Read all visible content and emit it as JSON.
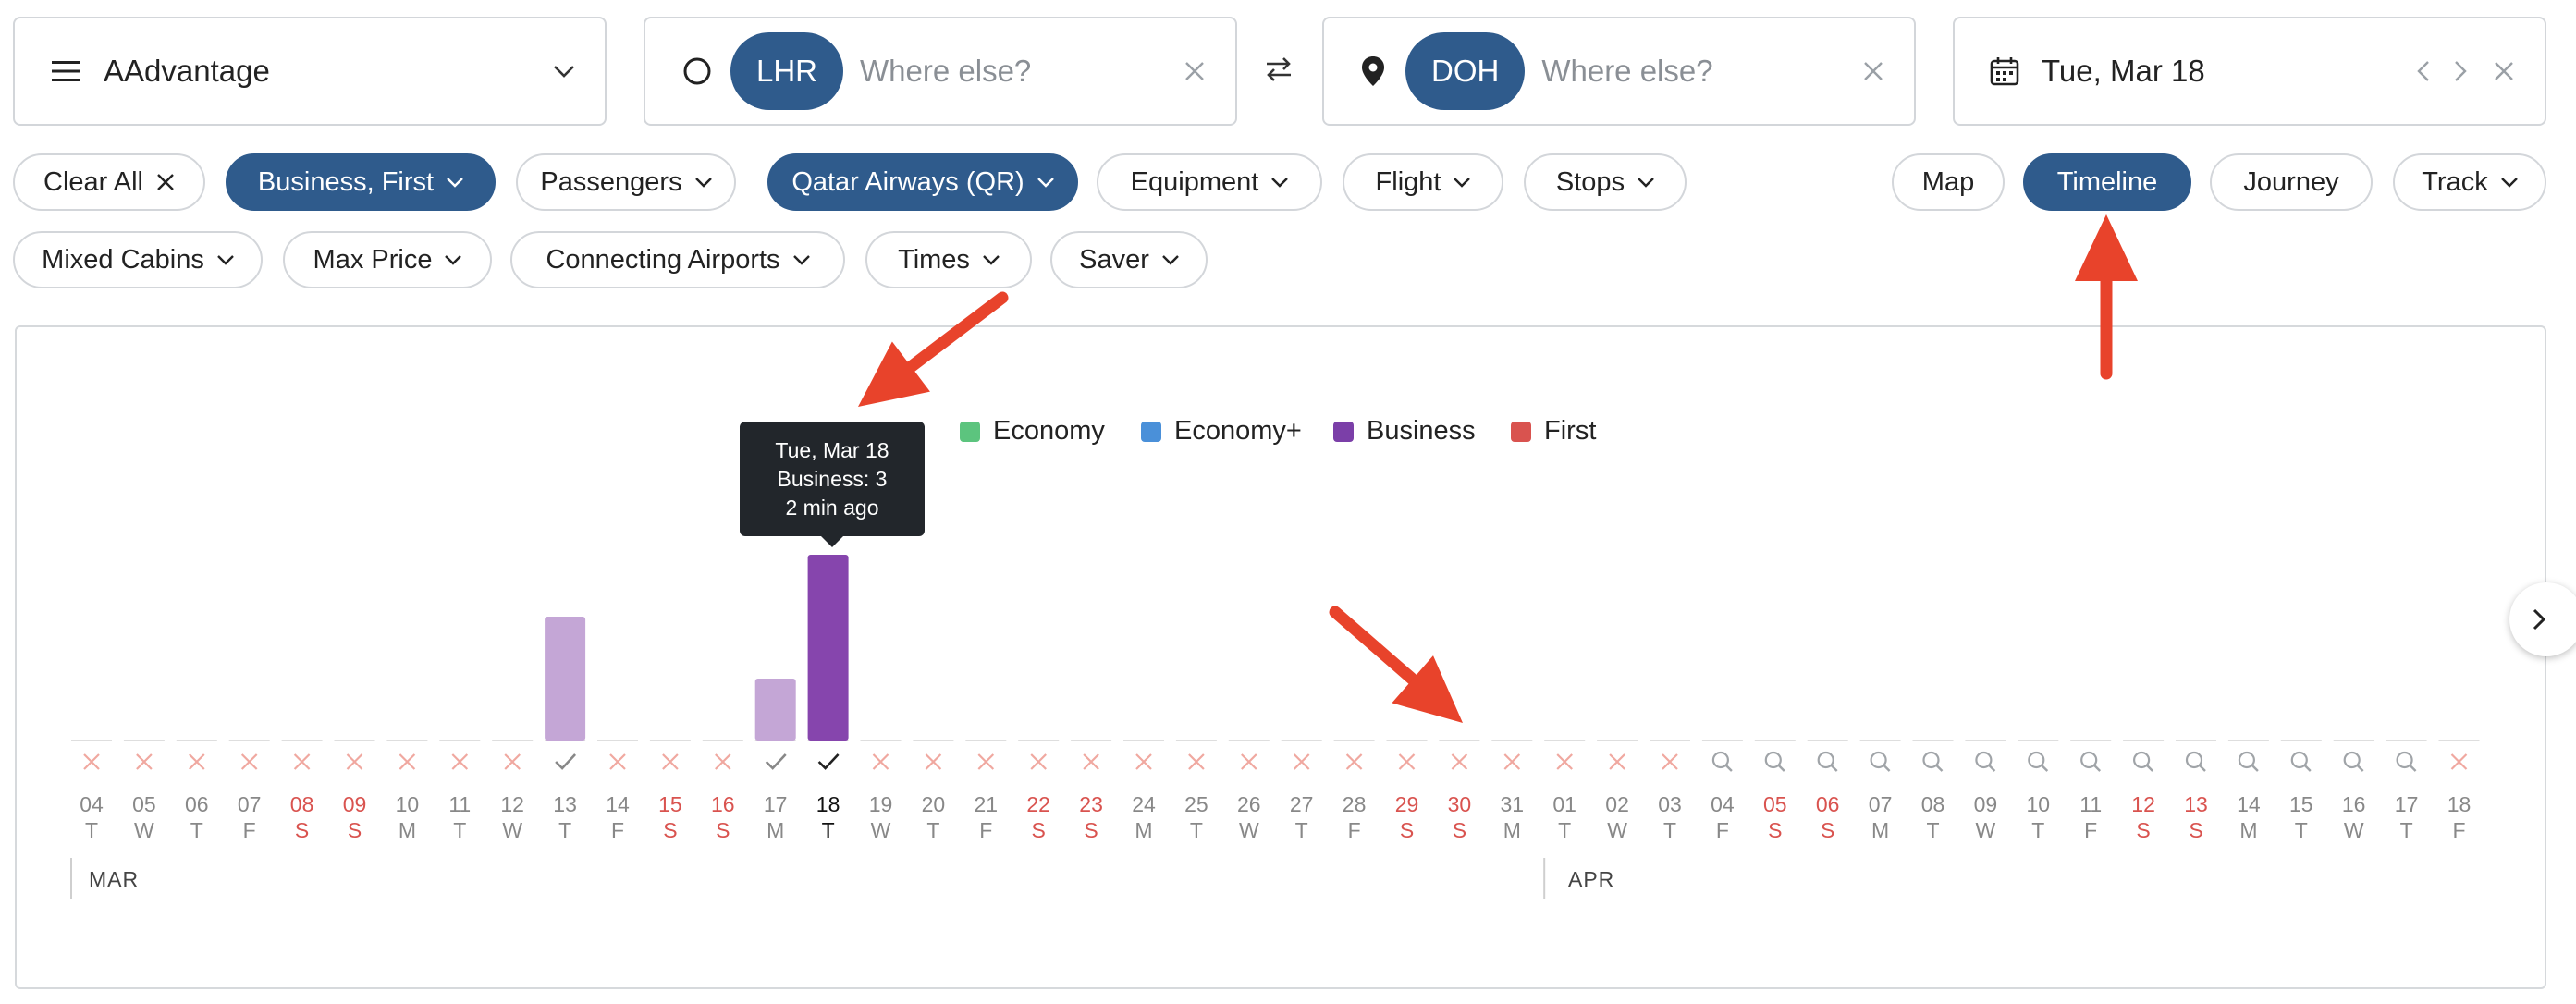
{
  "program": {
    "label": "AAdvantage"
  },
  "origin": {
    "code": "LHR",
    "placeholder": "Where else?"
  },
  "destination": {
    "code": "DOH",
    "placeholder": "Where else?"
  },
  "date": {
    "label": "Tue, Mar 18"
  },
  "filters_row1": [
    {
      "label": "Clear All",
      "active": false,
      "icon": "close-icon"
    },
    {
      "label": "Business, First",
      "active": true,
      "icon": "chevron-down-icon"
    },
    {
      "label": "Passengers",
      "active": false,
      "icon": "chevron-down-icon"
    },
    {
      "label": "Qatar Airways (QR)",
      "active": true,
      "icon": "chevron-down-icon"
    },
    {
      "label": "Equipment",
      "active": false,
      "icon": "chevron-down-icon"
    },
    {
      "label": "Flight",
      "active": false,
      "icon": "chevron-down-icon"
    },
    {
      "label": "Stops",
      "active": false,
      "icon": "chevron-down-icon"
    }
  ],
  "views": [
    {
      "label": "Map",
      "active": false
    },
    {
      "label": "Timeline",
      "active": true
    },
    {
      "label": "Journey",
      "active": false
    },
    {
      "label": "Track",
      "active": false,
      "icon": "chevron-down-icon"
    }
  ],
  "filters_row2": [
    {
      "label": "Mixed Cabins"
    },
    {
      "label": "Max Price"
    },
    {
      "label": "Connecting Airports"
    },
    {
      "label": "Times"
    },
    {
      "label": "Saver"
    }
  ],
  "legend": [
    {
      "label": "Economy",
      "color": "#5cc47e"
    },
    {
      "label": "Economy+",
      "color": "#4a90d9"
    },
    {
      "label": "Business",
      "color": "#7b3fa8"
    },
    {
      "label": "First",
      "color": "#d9534f"
    }
  ],
  "tooltip": {
    "date": "Tue, Mar 18",
    "detail": "Business: 3",
    "age": "2 min ago"
  },
  "colors": {
    "accent": "#2f5b8c",
    "business": "#8645ad",
    "business_light": "#c4a6d6",
    "weekend": "#d9534f",
    "arrow": "#e8432b",
    "cross": "#f0a8a0"
  },
  "chart_data": {
    "type": "bar",
    "series": [
      {
        "name": "Business",
        "values": [
          0,
          0,
          0,
          0,
          0,
          0,
          0,
          0,
          0,
          2,
          0,
          0,
          0,
          1,
          3,
          0,
          0,
          0,
          0,
          0,
          0,
          0,
          0,
          0,
          0,
          0,
          0,
          0,
          0,
          0,
          0,
          0,
          0,
          0,
          0,
          0,
          0,
          0,
          0,
          0,
          0,
          0,
          0,
          0,
          0,
          0
        ]
      }
    ],
    "days": [
      {
        "d": "04",
        "w": "T",
        "s": "x"
      },
      {
        "d": "05",
        "w": "W",
        "s": "x"
      },
      {
        "d": "06",
        "w": "T",
        "s": "x"
      },
      {
        "d": "07",
        "w": "F",
        "s": "x"
      },
      {
        "d": "08",
        "w": "S",
        "s": "x",
        "we": true
      },
      {
        "d": "09",
        "w": "S",
        "s": "x",
        "we": true
      },
      {
        "d": "10",
        "w": "M",
        "s": "x"
      },
      {
        "d": "11",
        "w": "T",
        "s": "x"
      },
      {
        "d": "12",
        "w": "W",
        "s": "x"
      },
      {
        "d": "13",
        "w": "T",
        "s": "check"
      },
      {
        "d": "14",
        "w": "F",
        "s": "x"
      },
      {
        "d": "15",
        "w": "S",
        "s": "x",
        "we": true
      },
      {
        "d": "16",
        "w": "S",
        "s": "x",
        "we": true
      },
      {
        "d": "17",
        "w": "M",
        "s": "check"
      },
      {
        "d": "18",
        "w": "T",
        "s": "check",
        "selected": true
      },
      {
        "d": "19",
        "w": "W",
        "s": "x"
      },
      {
        "d": "20",
        "w": "T",
        "s": "x"
      },
      {
        "d": "21",
        "w": "F",
        "s": "x"
      },
      {
        "d": "22",
        "w": "S",
        "s": "x",
        "we": true
      },
      {
        "d": "23",
        "w": "S",
        "s": "x",
        "we": true
      },
      {
        "d": "24",
        "w": "M",
        "s": "x"
      },
      {
        "d": "25",
        "w": "T",
        "s": "x"
      },
      {
        "d": "26",
        "w": "W",
        "s": "x"
      },
      {
        "d": "27",
        "w": "T",
        "s": "x"
      },
      {
        "d": "28",
        "w": "F",
        "s": "x"
      },
      {
        "d": "29",
        "w": "S",
        "s": "x",
        "we": true
      },
      {
        "d": "30",
        "w": "S",
        "s": "x",
        "we": true
      },
      {
        "d": "31",
        "w": "M",
        "s": "x"
      },
      {
        "d": "01",
        "w": "T",
        "s": "x"
      },
      {
        "d": "02",
        "w": "W",
        "s": "x"
      },
      {
        "d": "03",
        "w": "T",
        "s": "x"
      },
      {
        "d": "04",
        "w": "F",
        "s": "search"
      },
      {
        "d": "05",
        "w": "S",
        "s": "search",
        "we": true
      },
      {
        "d": "06",
        "w": "S",
        "s": "search",
        "we": true
      },
      {
        "d": "07",
        "w": "M",
        "s": "search"
      },
      {
        "d": "08",
        "w": "T",
        "s": "search"
      },
      {
        "d": "09",
        "w": "W",
        "s": "search"
      },
      {
        "d": "10",
        "w": "T",
        "s": "search"
      },
      {
        "d": "11",
        "w": "F",
        "s": "search"
      },
      {
        "d": "12",
        "w": "S",
        "s": "search",
        "we": true
      },
      {
        "d": "13",
        "w": "S",
        "s": "search",
        "we": true
      },
      {
        "d": "14",
        "w": "M",
        "s": "search"
      },
      {
        "d": "15",
        "w": "T",
        "s": "search"
      },
      {
        "d": "16",
        "w": "W",
        "s": "search"
      },
      {
        "d": "17",
        "w": "T",
        "s": "search"
      },
      {
        "d": "18",
        "w": "F",
        "s": "x"
      }
    ],
    "months": [
      {
        "label": "MAR",
        "startIndex": 0
      },
      {
        "label": "APR",
        "startIndex": 28
      }
    ],
    "ylim": [
      0,
      3
    ]
  }
}
